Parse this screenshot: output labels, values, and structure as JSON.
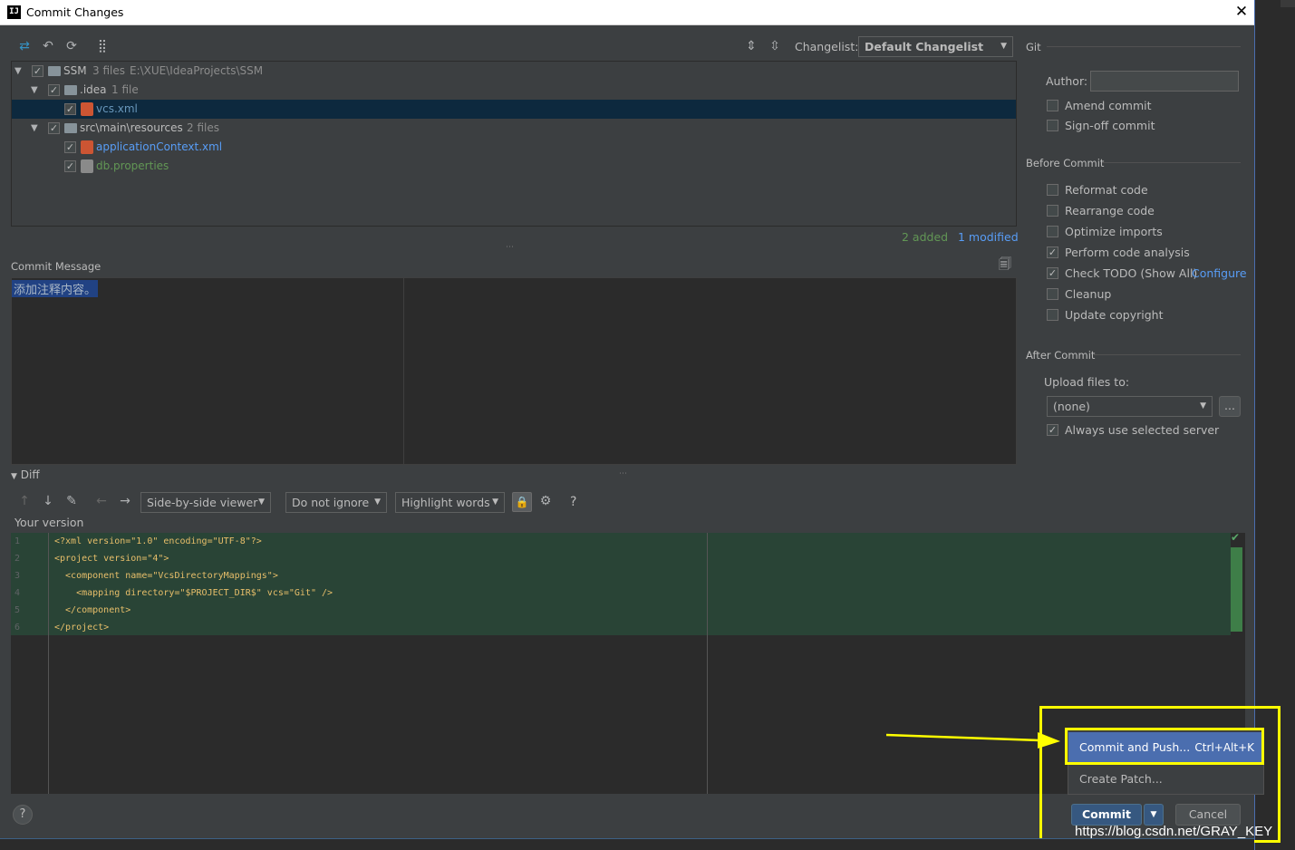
{
  "window": {
    "logo": "IJ",
    "title": "Commit Changes",
    "close": "✕"
  },
  "toolbar": {
    "changelist_label": "Changelist:",
    "changelist_value": "Default Changelist"
  },
  "tree": {
    "root": {
      "name": "SSM",
      "count": "3 files",
      "path": "E:\\XUE\\IdeaProjects\\SSM"
    },
    "idea_folder": {
      "name": ".idea",
      "count": "1 file"
    },
    "vcs_file": "vcs.xml",
    "resources_folder": {
      "name": "src\\main\\resources",
      "count": "2 files"
    },
    "app_ctx_file": "applicationContext.xml",
    "db_file": "db.properties"
  },
  "summary": {
    "added": "2 added",
    "modified": "1 modified"
  },
  "commit_message": {
    "label": "Commit Message",
    "text": "添加注释内容。"
  },
  "diff": {
    "label": "Diff",
    "viewer": "Side-by-side viewer",
    "ignore": "Do not ignore",
    "highlight": "Highlight words",
    "help": "?",
    "your_version": "Your version",
    "lines": [
      {
        "n": "1",
        "text": "<?xml version=\"1.0\" encoding=\"UTF-8\"?>"
      },
      {
        "n": "2",
        "text": "<project version=\"4\">"
      },
      {
        "n": "3",
        "text": "  <component name=\"VcsDirectoryMappings\">"
      },
      {
        "n": "4",
        "text": "    <mapping directory=\"$PROJECT_DIR$\" vcs=\"Git\" />"
      },
      {
        "n": "5",
        "text": "  </component>"
      },
      {
        "n": "6",
        "text": "</project>"
      }
    ]
  },
  "git": {
    "section": "Git",
    "author_label": "Author:",
    "amend": "Amend commit",
    "signoff": "Sign-off commit"
  },
  "before_commit": {
    "section": "Before Commit",
    "options": [
      {
        "label": "Reformat code",
        "checked": false
      },
      {
        "label": "Rearrange code",
        "checked": false
      },
      {
        "label": "Optimize imports",
        "checked": false
      },
      {
        "label": "Perform code analysis",
        "checked": true
      },
      {
        "label": "Check TODO (Show All)",
        "checked": true
      },
      {
        "label": "Cleanup",
        "checked": false
      },
      {
        "label": "Update copyright",
        "checked": false
      }
    ],
    "configure_link": "Configure"
  },
  "after_commit": {
    "section": "After Commit",
    "upload_label": "Upload files to:",
    "server_value": "(none)",
    "browse": "...",
    "always_use": "Always use selected server"
  },
  "popup": {
    "commit_push": "Commit and Push...",
    "commit_push_shortcut": "Ctrl+Alt+K",
    "create_patch": "Create Patch..."
  },
  "buttons": {
    "commit": "Commit",
    "cancel": "Cancel",
    "help": "?"
  },
  "watermark": "https://blog.csdn.net/GRAY_KEY",
  "colors": {
    "highlight_yellow": "#ffff00",
    "accent_blue": "#4b6eaf",
    "added_green": "#629755",
    "modified_blue": "#6897bb"
  }
}
